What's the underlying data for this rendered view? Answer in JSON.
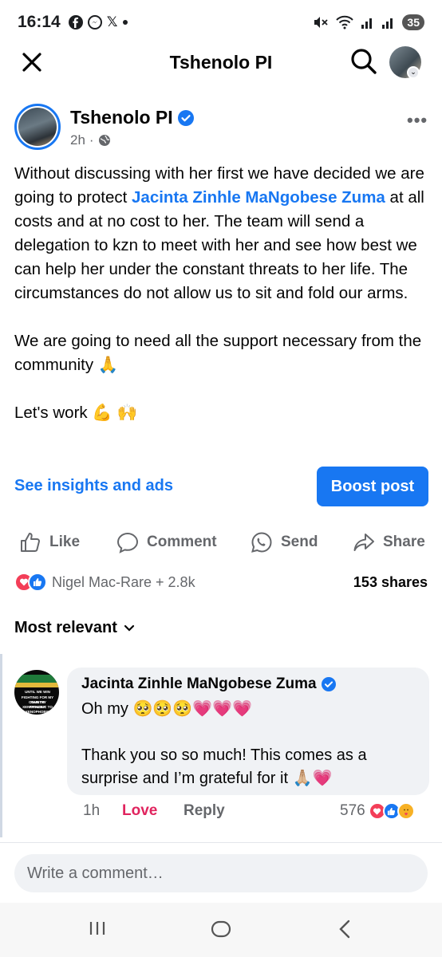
{
  "status_bar": {
    "time": "16:14",
    "notif_icons": [
      "facebook-icon",
      "messenger-icon",
      "x-icon",
      "dot-icon"
    ],
    "x_glyph": "𝕏",
    "battery": "35",
    "wifi_band": "5"
  },
  "header": {
    "title": "Tshenolo PI",
    "chevron": "⌄"
  },
  "post": {
    "author": "Tshenolo PI",
    "time": "2h",
    "separator": "·",
    "more": "•••",
    "body_line1_before": "Without discussing with her first we have decided we are going to protect ",
    "mention": "Jacinta Zinhle MaNgobese Zuma",
    "body_line1_after": " at all costs and at no cost to her. The team will send a delegation to kzn to meet with her and see how best we can help her under the constant threats to her life. The circumstances do not allow us to sit and fold our arms.",
    "body_p2": "We are going to need all the support necessary from the community 🙏",
    "body_p3": "Let's work 💪 🙌",
    "insights_label": "See insights and ads",
    "boost_label": "Boost post"
  },
  "actions": {
    "like": "Like",
    "comment": "Comment",
    "send": "Send",
    "share": "Share"
  },
  "reactions": {
    "summary": "Nigel Mac-Rare + 2.8k",
    "shares": "153 shares"
  },
  "sort": {
    "label": "Most relevant",
    "chevron": "⌄"
  },
  "comment": {
    "avatar_text": [
      "UNTIL WE WIN",
      "FIGHTING FOR MY COUNTRY",
      "MAN I'M XENOPHOBIC TO",
      "PROUDLY XENOPHOBIC"
    ],
    "author": "Jacinta Zinhle MaNgobese Zuma",
    "text_p1": "Oh my 🥺🥺🥺💗💗💗",
    "text_p2": "Thank you so so much! This comes as a surprise and I’m grateful for it 🙏🏼💗",
    "time": "1h",
    "love_label": "Love",
    "reply_label": "Reply",
    "reaction_count": "576",
    "reaction_icons": [
      "love",
      "like",
      "care"
    ]
  },
  "composer": {
    "placeholder": "Write a comment…"
  },
  "colors": {
    "brand_blue": "#1877f2",
    "love_red": "#f33e58",
    "love_text": "#e0245e",
    "secondary_text": "#65676b",
    "bubble_bg": "#f0f2f5"
  }
}
